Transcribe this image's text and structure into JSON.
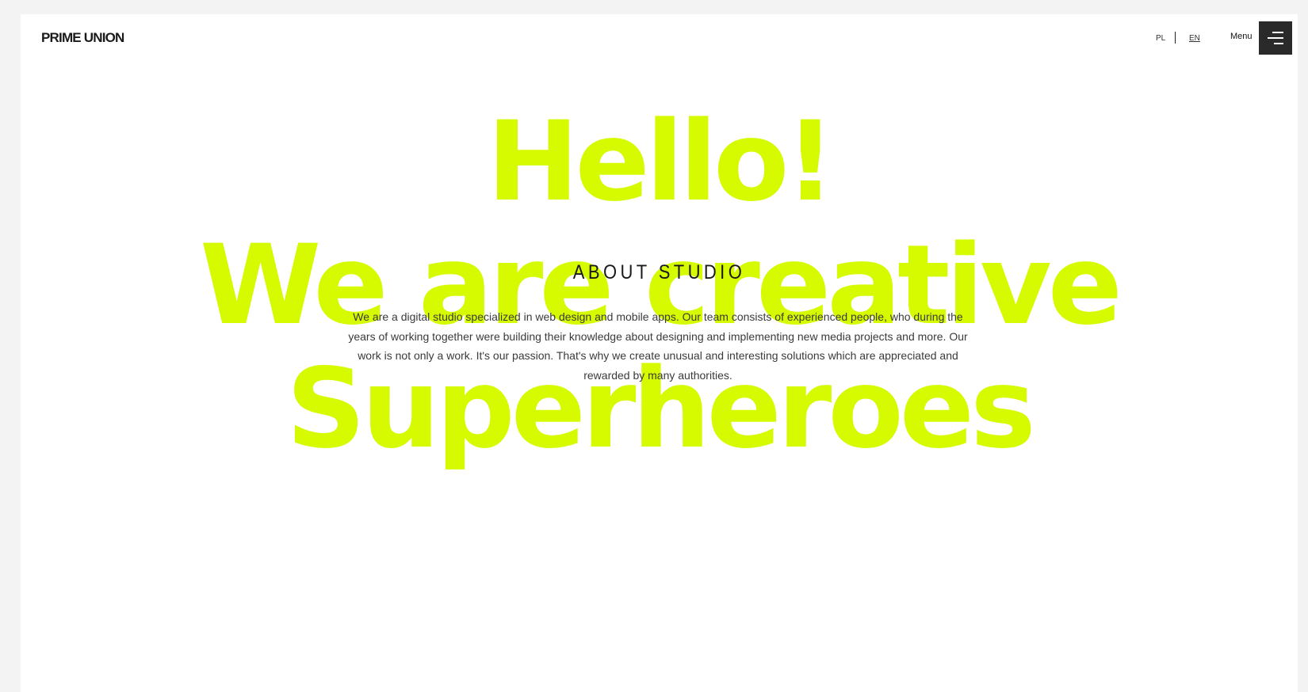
{
  "header": {
    "logo": "PRIME UNION",
    "languages": [
      "PL",
      "EN"
    ],
    "active_language": "EN",
    "menu_label": "Menu"
  },
  "hero": {
    "line1": "Hello!",
    "line2": "We are creative",
    "line3": "Superheroes"
  },
  "about": {
    "title": "ABOUT STUDIO",
    "text": "We are a digital studio specialized in web design and mobile apps. Our team consists of experienced people, who during the years of working together were building their knowledge about designing and implementing new media projects and more. Our work is not only a work. It's our passion. That's why we create unusual and interesting solutions which are appreciated and rewarded by many authorities."
  },
  "colors": {
    "accent": "#d6fa00",
    "text": "#1a1a1a",
    "background": "#ffffff",
    "outer_background": "#f3f3f3",
    "menu_button": "#2a2a2a"
  },
  "icons": {
    "menu": "hamburger-menu-icon"
  }
}
